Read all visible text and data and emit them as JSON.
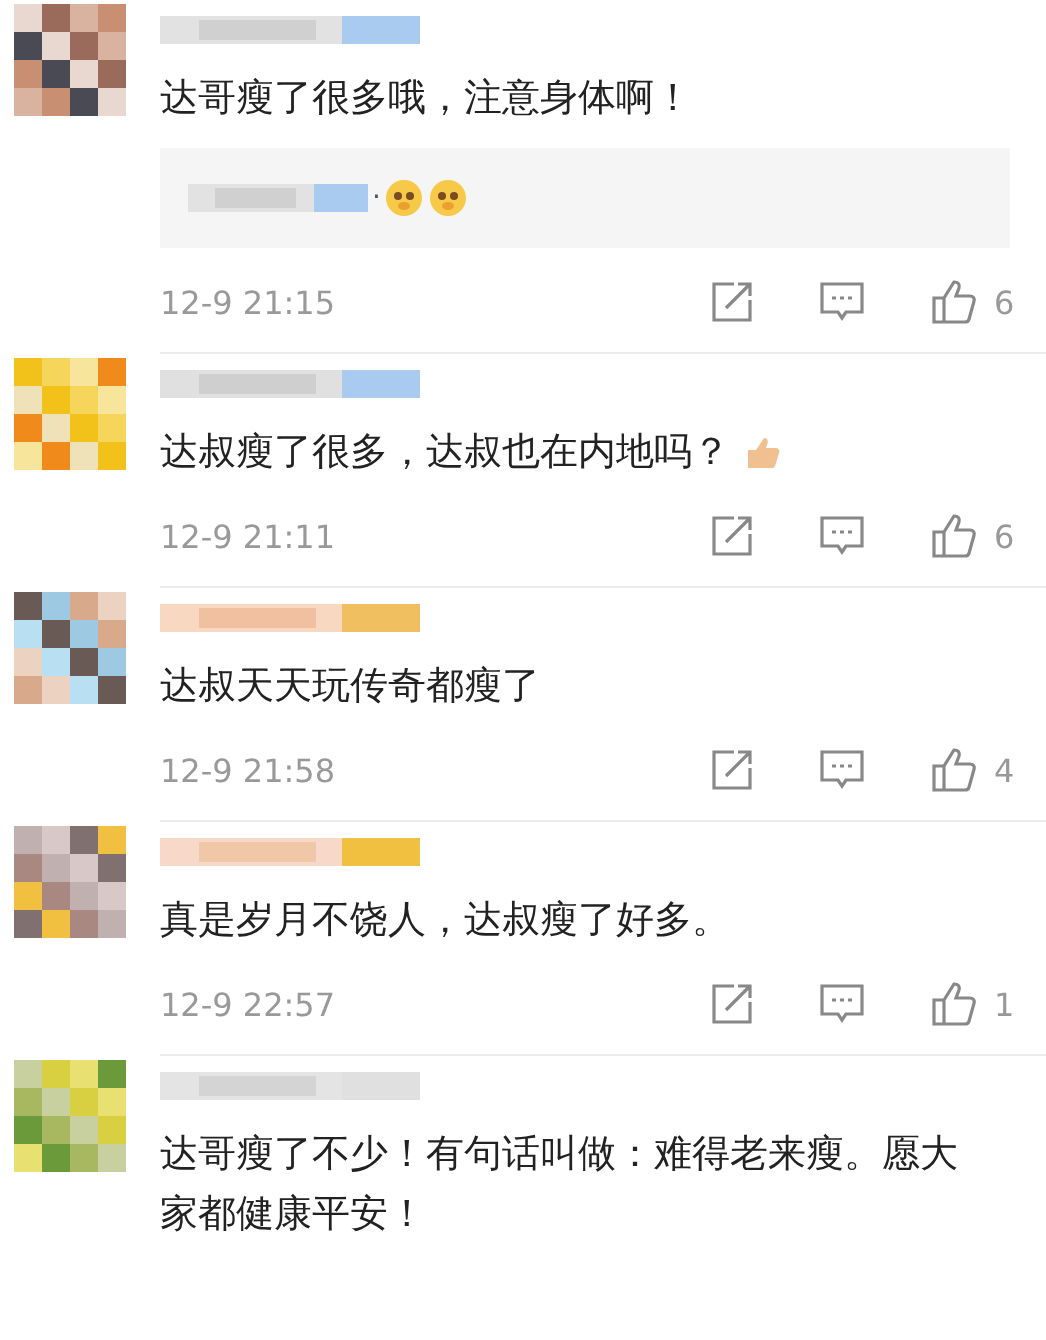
{
  "comments": [
    {
      "kind": "plain",
      "text": "达哥瘦了很多哦，注意身体啊！",
      "reply": {
        "text": "·"
      },
      "time": "12-9 21:15",
      "likes": "6"
    },
    {
      "kind": "with-emoji",
      "text": "达叔瘦了很多，达叔也在内地吗？",
      "time": "12-9 21:11",
      "likes": "6"
    },
    {
      "kind": "plain",
      "text": "达叔天天玩传奇都瘦了",
      "time": "12-9 21:58",
      "likes": "4"
    },
    {
      "kind": "plain",
      "text": "真是岁月不饶人，达叔瘦了好多。",
      "time": "12-9 22:57",
      "likes": "1"
    },
    {
      "kind": "plain",
      "text": "达哥瘦了不少！有句话叫做：难得老来瘦。愿大家都健康平安！"
    }
  ]
}
